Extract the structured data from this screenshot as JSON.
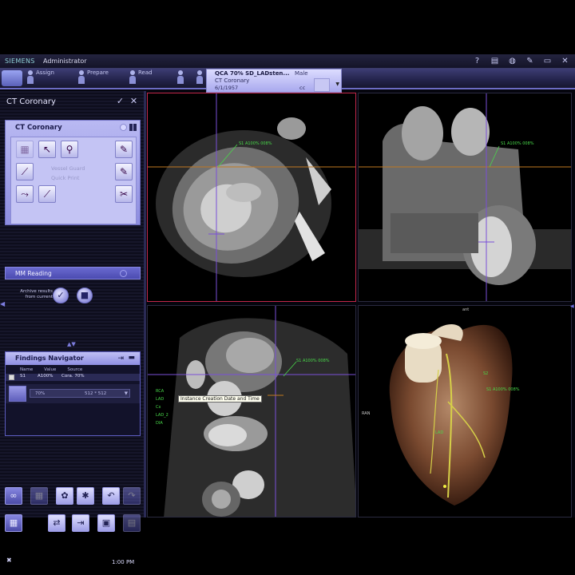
{
  "header": {
    "brand": "SIEMENS",
    "user": "Administrator",
    "icons": [
      "help-icon",
      "clipboard-icon",
      "globe-icon",
      "wrench-icon",
      "monitor-icon",
      "close-icon"
    ]
  },
  "workflow_tabs": [
    {
      "label": "Assign"
    },
    {
      "label": "Prepare"
    },
    {
      "label": "Read"
    }
  ],
  "patient": {
    "name": "QCA 70% SD_LADsten...",
    "sex": "Male",
    "study": "CT Coronary",
    "dob": "6/1/1957",
    "orientation": "cc"
  },
  "left_panel": {
    "title": "CT Coronary",
    "workflow_card": {
      "title": "CT Coronary",
      "tools": [
        "volume-icon",
        "pointer-icon",
        "magnify-icon",
        "pen-icon",
        "syringe-icon",
        "pen-icon",
        "vessel-tool-icon",
        "measure-icon",
        "vessel-cut-icon"
      ],
      "dim_labels": [
        "Vessel Guard",
        "Quick Print"
      ],
      "mm_reading": "MM Reading"
    },
    "archive_label": "Archive results from current",
    "archive_buttons": [
      "check-icon",
      "stop-icon"
    ]
  },
  "findings": {
    "title": "Findings Navigator",
    "columns": [
      "Name",
      "Value",
      "Source"
    ],
    "rows": [
      {
        "name": "S1",
        "value": "A100%",
        "source": "Cora. 70%"
      }
    ],
    "control_value": "70%",
    "control_dims": "512 * 512"
  },
  "toolbar_buttons": [
    "link-icon",
    "grid-icon",
    "flower-icon",
    "star-icon",
    "undo-icon",
    "redo-icon",
    "layout-icon",
    "arrows-icon",
    "export-icon",
    "save-icon",
    "lock-icon"
  ],
  "status": {
    "time": "1:00 PM"
  },
  "viewports": {
    "top_left": {
      "vessel_label": "S1 A100% 008%"
    },
    "top_right": {
      "vessel_label": "S1 A100% 008%"
    },
    "bottom_left": {
      "vessel_label": "S1 A100% 008%",
      "tooltip": "Instance Creation Date and Time",
      "labels": [
        "RCA",
        "LAD",
        "Cx",
        "LAD_2",
        "DIA"
      ]
    },
    "bottom_right": {
      "vessel_labels": [
        "S1 A100% 008%",
        "S2",
        "LAD"
      ],
      "orientation_top": "ant",
      "orientation_left": "RAN"
    }
  },
  "colors": {
    "accent": "#8d8de0",
    "active_border": "#c2284a",
    "crosshair_h": "#c07820",
    "crosshair_v": "#7a4fd8",
    "vessel_label": "#49d94a"
  }
}
